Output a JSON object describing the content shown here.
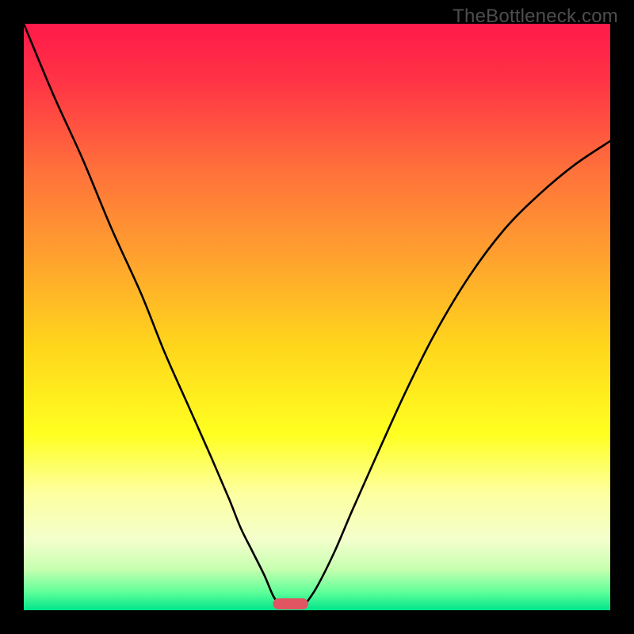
{
  "watermark": "TheBottleneck.com",
  "chart_data": {
    "type": "line",
    "title": "",
    "xlabel": "",
    "ylabel": "",
    "xlim": [
      0,
      100
    ],
    "ylim": [
      0,
      100
    ],
    "background_gradient": {
      "stops": [
        {
          "offset": 0.0,
          "color": "#ff1a4a"
        },
        {
          "offset": 0.1,
          "color": "#ff3445"
        },
        {
          "offset": 0.25,
          "color": "#ff713b"
        },
        {
          "offset": 0.4,
          "color": "#ffa22e"
        },
        {
          "offset": 0.55,
          "color": "#ffd61c"
        },
        {
          "offset": 0.7,
          "color": "#ffff20"
        },
        {
          "offset": 0.8,
          "color": "#fdffa0"
        },
        {
          "offset": 0.88,
          "color": "#f3ffcc"
        },
        {
          "offset": 0.93,
          "color": "#c7ffb0"
        },
        {
          "offset": 0.97,
          "color": "#5dff99"
        },
        {
          "offset": 1.0,
          "color": "#00e58a"
        }
      ]
    },
    "series": [
      {
        "name": "left-branch",
        "x": [
          0,
          5,
          10,
          15,
          20,
          24,
          28,
          32,
          35,
          37,
          39,
          41,
          42.5,
          43.5
        ],
        "y": [
          100,
          88,
          77,
          65,
          54,
          44,
          35,
          26,
          19,
          14,
          10,
          6,
          2.5,
          1
        ]
      },
      {
        "name": "right-branch",
        "x": [
          48,
          50,
          53,
          56,
          60,
          65,
          70,
          76,
          82,
          88,
          94,
          100
        ],
        "y": [
          1,
          4,
          10,
          17,
          26,
          37,
          47,
          57,
          65,
          71,
          76,
          80
        ]
      }
    ],
    "marker": {
      "name": "minimum-marker",
      "x_center": 45.5,
      "width": 6,
      "color": "#e15562"
    }
  }
}
